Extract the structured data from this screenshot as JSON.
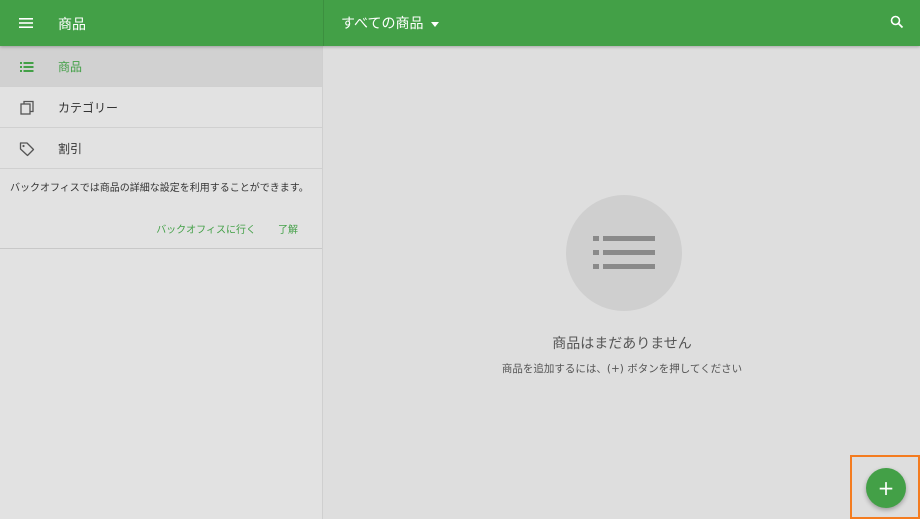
{
  "topbar": {
    "title": "商品",
    "filter_label": "すべての商品"
  },
  "sidebar": {
    "items": [
      {
        "label": "商品",
        "icon": "list-icon",
        "active": true
      },
      {
        "label": "カテゴリー",
        "icon": "copy-icon",
        "active": false
      },
      {
        "label": "割引",
        "icon": "tag-icon",
        "active": false
      }
    ],
    "notice": {
      "message": "バックオフィスでは商品の詳細な設定を利用することができます。",
      "go_backoffice": "バックオフィスに行く",
      "dismiss": "了解"
    }
  },
  "main": {
    "empty_title": "商品はまだありません",
    "empty_subtitle": "商品を追加するには、(+) ボタンを押してください"
  },
  "fab": {
    "symbol": "+"
  },
  "colors": {
    "primary": "#43a047",
    "highlight_frame": "#f47c20"
  }
}
